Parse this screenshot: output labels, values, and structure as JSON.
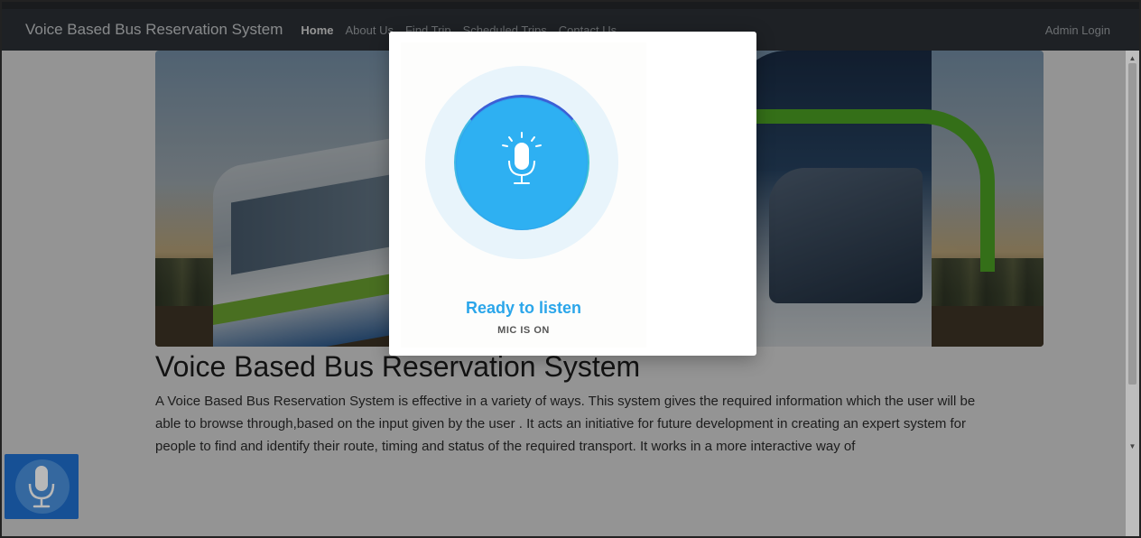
{
  "navbar": {
    "brand": "Voice Based Bus Reservation System",
    "links": [
      "Home",
      "About Us",
      "Find Trip",
      "Scheduled Trips",
      "Contact Us"
    ],
    "admin_login": "Admin Login"
  },
  "main": {
    "title": "Voice Based Bus Reservation System",
    "description": "A Voice Based Bus Reservation System is effective in a variety of ways. This system gives the required information which the user will be able to browse through,based on the input given by the user . It acts an initiative for future development in creating an expert system for people to find and identify their route, timing and status of the required transport. It works in a more interactive way of"
  },
  "voice_modal": {
    "status_title": "Ready to listen",
    "status_sub": "MIC IS ON",
    "icon": "microphone-icon"
  },
  "floating_mic": {
    "icon": "microphone-icon"
  },
  "colors": {
    "navbar": "#343a40",
    "mic_blue": "#2eb0f2",
    "listen_text": "#2ba6ea",
    "float_button": "#1f6fcf"
  }
}
